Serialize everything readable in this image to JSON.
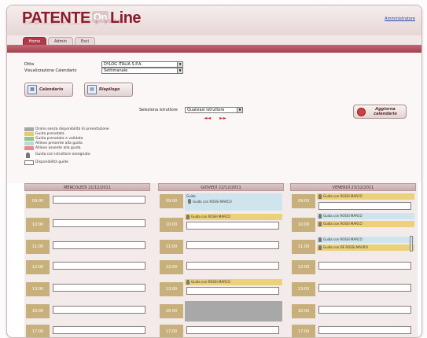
{
  "header": {
    "logo_main": "PATENTE",
    "logo_on": "On",
    "logo_line": "Line",
    "admin_link": "Amministratore"
  },
  "tabs": [
    {
      "label": "Home"
    },
    {
      "label": "Admin"
    },
    {
      "label": "Esci"
    }
  ],
  "form": {
    "ditta_label": "Ditta",
    "ditta_value": "DYLOG ITALIA S.P.A.",
    "vis_label": "Visualizzazione Calendario",
    "vis_value": "Settimanale",
    "calendario_btn": "Calendario",
    "riepilogo_btn": "Riepilogo",
    "istruttore_label": "Seleziona istruttore",
    "istruttore_value": "Qualsiasi istruttore",
    "prev": "◄◄",
    "next": "►►",
    "aggiorna_line1": "Aggiorna",
    "aggiorna_line2": "calendario"
  },
  "legend": [
    {
      "text": "Orario senza disponibilità di prenotazione",
      "color": "#a8a8a8"
    },
    {
      "text": "Guida prenotata",
      "color": "#e8c870"
    },
    {
      "text": "Guida prenotata e validata",
      "color": "#8fc87f"
    },
    {
      "text": "Allievo presente alla guida",
      "color": "#b8d8e8"
    },
    {
      "text": "Allievo assente alla guida",
      "color": "#e88a8a"
    },
    {
      "text": "Guida con istruttore assegnato",
      "color": "#ffffff"
    },
    {
      "text": "Disponibilità guide",
      "color": "#ffffff"
    }
  ],
  "calendar": {
    "days": [
      "MERCOLEDÌ 21/12/2011",
      "GIOVEDÌ 22/12/2011",
      "VENERDÌ 23/12/2011"
    ],
    "times": [
      "09:00",
      "10:00",
      "11:00",
      "12:00",
      "13:00",
      "16:00",
      "17:00"
    ],
    "guide_label": "Guida",
    "entries": {
      "giovedi_0900": "Guida con ROSSI MARCO",
      "giovedi_1000": "Guida con ROSSI MARCO",
      "giovedi_1500": "Guida con ROSSI MARCO",
      "venerdi_0900": "Guida con ROSSI MARCO",
      "venerdi_1000a": "Guida con ROSSI MARCO",
      "venerdi_1000b": "Guida con ROSSI MARCO",
      "venerdi_1100a": "Guida con ROSSI MARCO",
      "venerdi_1100b": "Guida con DE ROSSI MAURO"
    }
  }
}
